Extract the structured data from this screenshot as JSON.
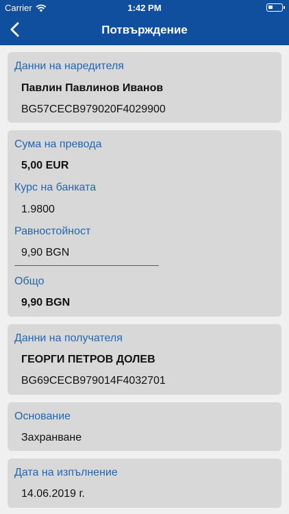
{
  "status_bar": {
    "carrier": "Carrier",
    "time": "1:42 PM"
  },
  "nav": {
    "title": "Потвърждение"
  },
  "sender": {
    "label": "Данни на наредителя",
    "name": "Павлин Павлинов Иванов",
    "iban": "BG57CECB979020F4029900"
  },
  "transfer": {
    "amount_label": "Сума на превода",
    "amount": "5,00 EUR",
    "rate_label": "Курс на банката",
    "rate": "1.9800",
    "equivalent_label": "Равностойност",
    "equivalent": "9,90 BGN",
    "total_label": "Общо",
    "total": "9,90 BGN"
  },
  "recipient": {
    "label": "Данни на получателя",
    "name": "ГЕОРГИ ПЕТРОВ ДОЛЕВ",
    "iban": "BG69CECB979014F4032701"
  },
  "reason": {
    "label": "Основание",
    "value": "Захранване"
  },
  "execution": {
    "label": "Дата на изпълнение",
    "value": "14.06.2019 г."
  },
  "colors": {
    "header": "#0f4f9e",
    "label": "#2466b0",
    "card": "#d8d8d8",
    "background": "#f0f0f0"
  }
}
